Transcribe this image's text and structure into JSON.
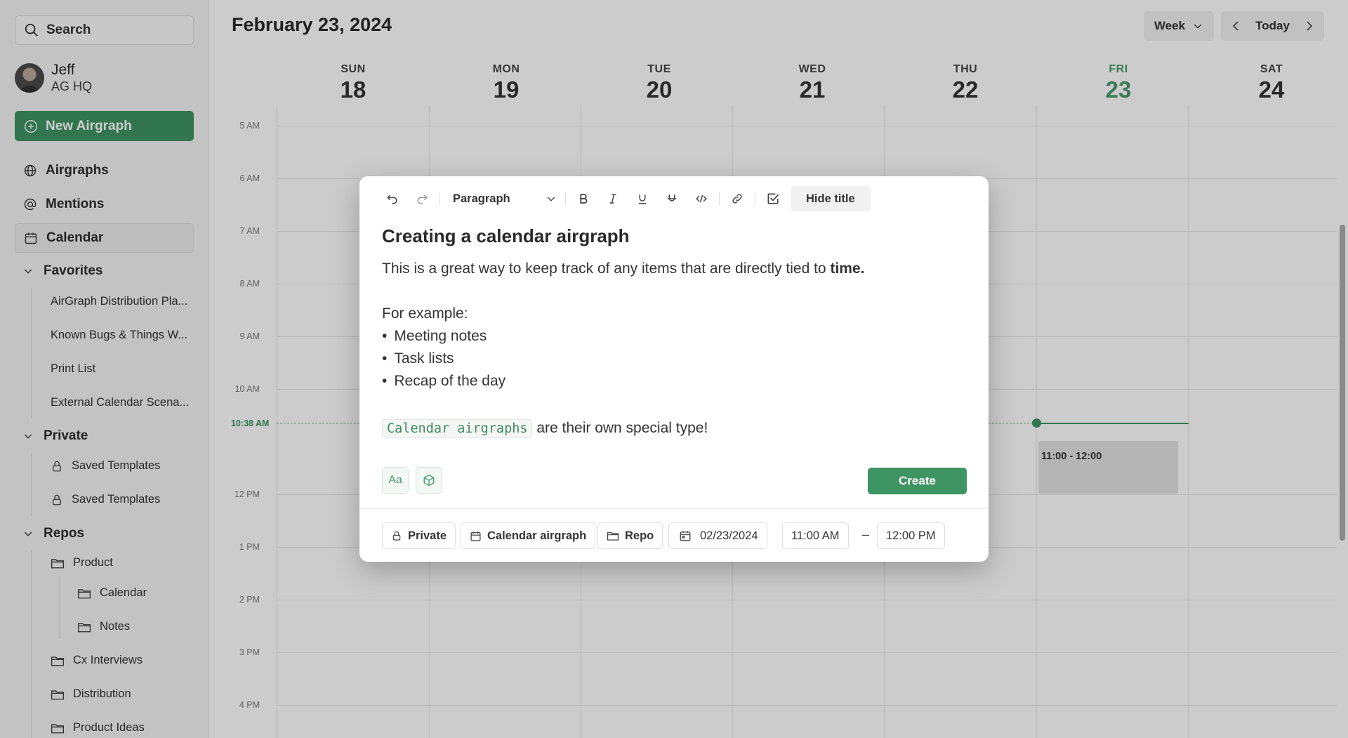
{
  "sidebar": {
    "search_label": "Search",
    "user": {
      "name": "Jeff",
      "org": "AG HQ"
    },
    "new_button": "New Airgraph",
    "nav": [
      {
        "label": "Airgraphs"
      },
      {
        "label": "Mentions"
      },
      {
        "label": "Calendar",
        "active": true
      }
    ],
    "favorites": {
      "label": "Favorites",
      "items": [
        "AirGraph Distribution Pla...",
        "Known Bugs & Things W...",
        "Print List",
        "External Calendar Scena..."
      ]
    },
    "private": {
      "label": "Private",
      "items": [
        "Saved Templates",
        "Saved Templates"
      ]
    },
    "repos": {
      "label": "Repos",
      "items": [
        "Product",
        "Calendar",
        "Notes",
        "Cx Interviews",
        "Distribution",
        "Product Ideas"
      ]
    }
  },
  "header": {
    "date": "February 23, 2024",
    "view": "Week",
    "today": "Today"
  },
  "days": [
    {
      "name": "SUN",
      "num": "18"
    },
    {
      "name": "MON",
      "num": "19"
    },
    {
      "name": "TUE",
      "num": "20"
    },
    {
      "name": "WED",
      "num": "21"
    },
    {
      "name": "THU",
      "num": "22"
    },
    {
      "name": "FRI",
      "num": "23",
      "today": true
    },
    {
      "name": "SAT",
      "num": "24"
    }
  ],
  "hours": [
    "5 AM",
    "6 AM",
    "7 AM",
    "8 AM",
    "9 AM",
    "10 AM",
    "12 PM",
    "1 PM",
    "2 PM",
    "3 PM",
    "4 PM"
  ],
  "now_label": "10:38 AM",
  "event": {
    "time": "11:00 - 12:00"
  },
  "editor": {
    "paragraph_style": "Paragraph",
    "hide_title": "Hide title",
    "title": "Creating a calendar airgraph",
    "line1_prefix": "This is a great way to keep track of any items that are directly tied to ",
    "line1_bold": "time.",
    "example_label": "For example:",
    "bullets": [
      "Meeting notes",
      "Task lists",
      "Recap of the day"
    ],
    "code_text": "Calendar airgraphs",
    "code_suffix": " are their own special type!",
    "font_button": "Aa",
    "create_label": "Create",
    "footer": {
      "visibility": "Private",
      "type": "Calendar airgraph",
      "repo": "Repo",
      "date": "02/23/2024",
      "start_time": "11:00 AM",
      "dash": "–",
      "end_time": "12:00 PM"
    }
  },
  "colors": {
    "accent": "#3f9463",
    "today": "#4c9a6c"
  }
}
